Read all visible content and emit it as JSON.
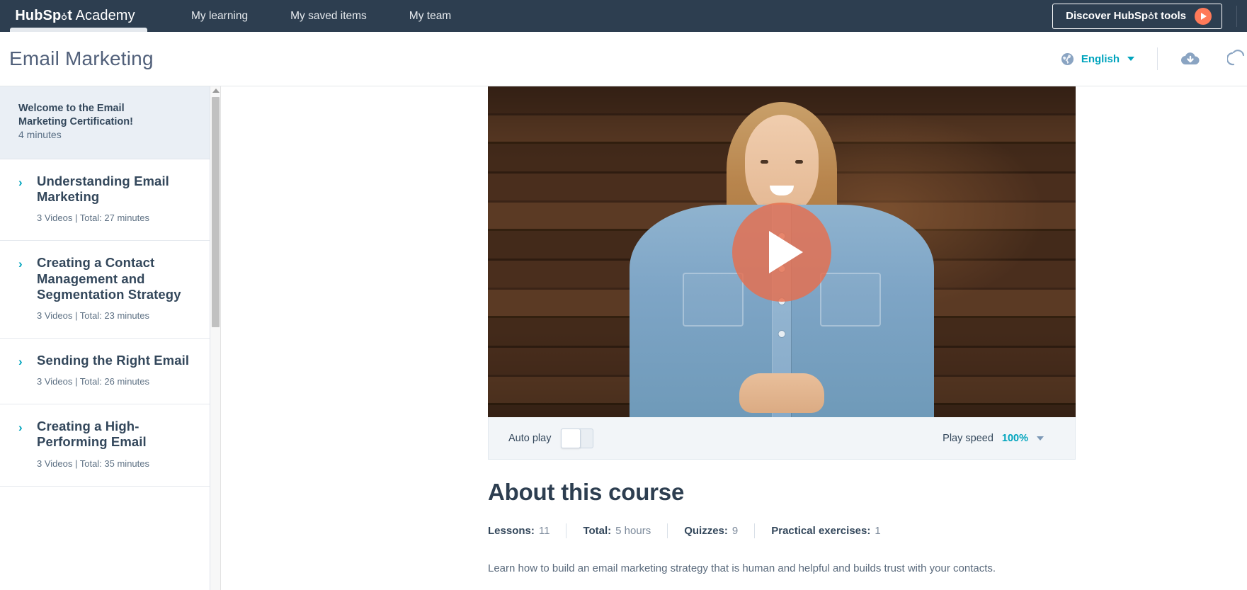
{
  "topnav": {
    "brand_bold": "HubSp",
    "brand_bold_tail": "t",
    "brand_light": "Academy",
    "links": [
      {
        "label": "My learning"
      },
      {
        "label": "My saved items"
      },
      {
        "label": "My team"
      }
    ],
    "discover_button": "Discover HubSpöt tools",
    "discover_button_prefix": "Discover HubSp",
    "discover_button_suffix": "t tools",
    "icons": {
      "play": "play-icon"
    },
    "colors": {
      "bar": "#2d3e50",
      "accent_orange": "#ff7a59"
    }
  },
  "subheader": {
    "title": "Email Marketing",
    "language": "English",
    "icons": {
      "globe": "globe-icon",
      "caret": "chevron-down-icon",
      "cloud": "cloud-download-icon",
      "edge": "bookmark-icon"
    }
  },
  "sidebar": {
    "welcome": {
      "title": "Welcome to the Email Marketing Certification!",
      "meta": "4 minutes"
    },
    "items": [
      {
        "title": "Understanding Email Marketing",
        "meta": "3 Videos | Total: 27 minutes"
      },
      {
        "title": "Creating a Contact Management and Segmentation Strategy",
        "meta": "3 Videos | Total: 23 minutes"
      },
      {
        "title": "Sending the Right Email",
        "meta": "3 Videos | Total: 26 minutes"
      },
      {
        "title": "Creating a High-Performing Email",
        "meta": "3 Videos | Total: 35 minutes"
      }
    ],
    "chevron_glyph": "›"
  },
  "player": {
    "autoplay_label": "Auto play",
    "autoplay_on": false,
    "play_speed_label": "Play speed",
    "play_speed_value": "100%",
    "play_button": "play-button"
  },
  "about": {
    "heading": "About this course",
    "stats": [
      {
        "key": "Lessons:",
        "value": "11"
      },
      {
        "key": "Total:",
        "value": "5 hours"
      },
      {
        "key": "Quizzes:",
        "value": "9"
      },
      {
        "key": "Practical exercises:",
        "value": "1"
      }
    ],
    "description": "Learn how to build an email marketing strategy that is human and helpful and builds trust with your contacts."
  }
}
